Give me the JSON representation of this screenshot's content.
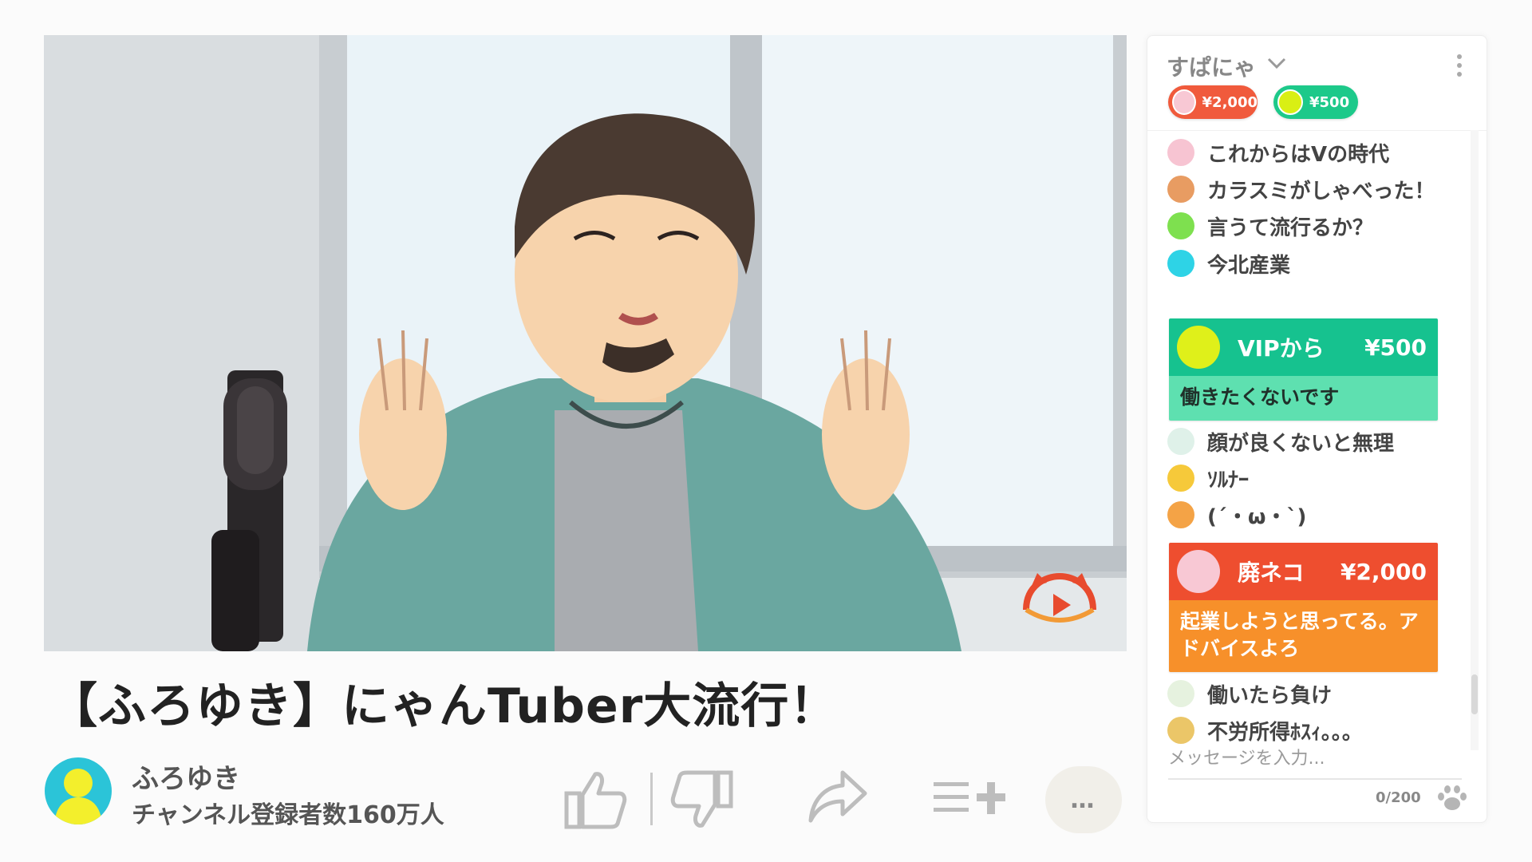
{
  "video": {
    "title": "【ふろゆき】にゃんTuber大流行！",
    "channel_name": "ふろゆき",
    "subscriber_count": "チャンネル登録者数160万人"
  },
  "actions": {
    "like_icon": "thumbs-up-icon",
    "dislike_icon": "thumbs-down-icon",
    "share_icon": "share-arrow-icon",
    "save_icon": "add-to-playlist-icon",
    "more_label": "…"
  },
  "chat": {
    "title": "すぱにゃ",
    "tickers": [
      {
        "amount": "¥2,000",
        "color": "#f05a3c",
        "avatar_color": "#f8c8d4"
      },
      {
        "amount": "¥500",
        "color": "#1dc98a",
        "avatar_color": "#d9ef14"
      }
    ],
    "messages": [
      {
        "text": "これからはVの時代",
        "color": "#f7c4d2"
      },
      {
        "text": "カラスミがしゃべった！",
        "color": "#e89c62"
      },
      {
        "text": "言うて流行るか？",
        "color": "#7ee04f"
      },
      {
        "text": "今北産業",
        "color": "#2ed3e6"
      },
      {
        "text": "顔が良くないと無理",
        "color": "#dff1e9"
      },
      {
        "text": "ｿﾙﾅｰ",
        "color": "#f6c93a"
      },
      {
        "text": "(´・ω・`)",
        "color": "#f4a346"
      },
      {
        "text": "働いたら負け",
        "color": "#e6f2df"
      },
      {
        "text": "不労所得ﾎｽｨ｡｡｡",
        "color": "#ebc668"
      }
    ],
    "superchats": [
      {
        "name": "VIPから",
        "amount": "¥500",
        "message": "働きたくないです",
        "avatar_color": "#dff01a"
      },
      {
        "name": "廃ネコ",
        "amount": "¥2,000",
        "message": "起業しようと思ってる。アドバイスよろ",
        "avatar_color": "#f8c8d4"
      }
    ],
    "input_placeholder": "メッセージを入力...",
    "char_count": "0/200"
  }
}
